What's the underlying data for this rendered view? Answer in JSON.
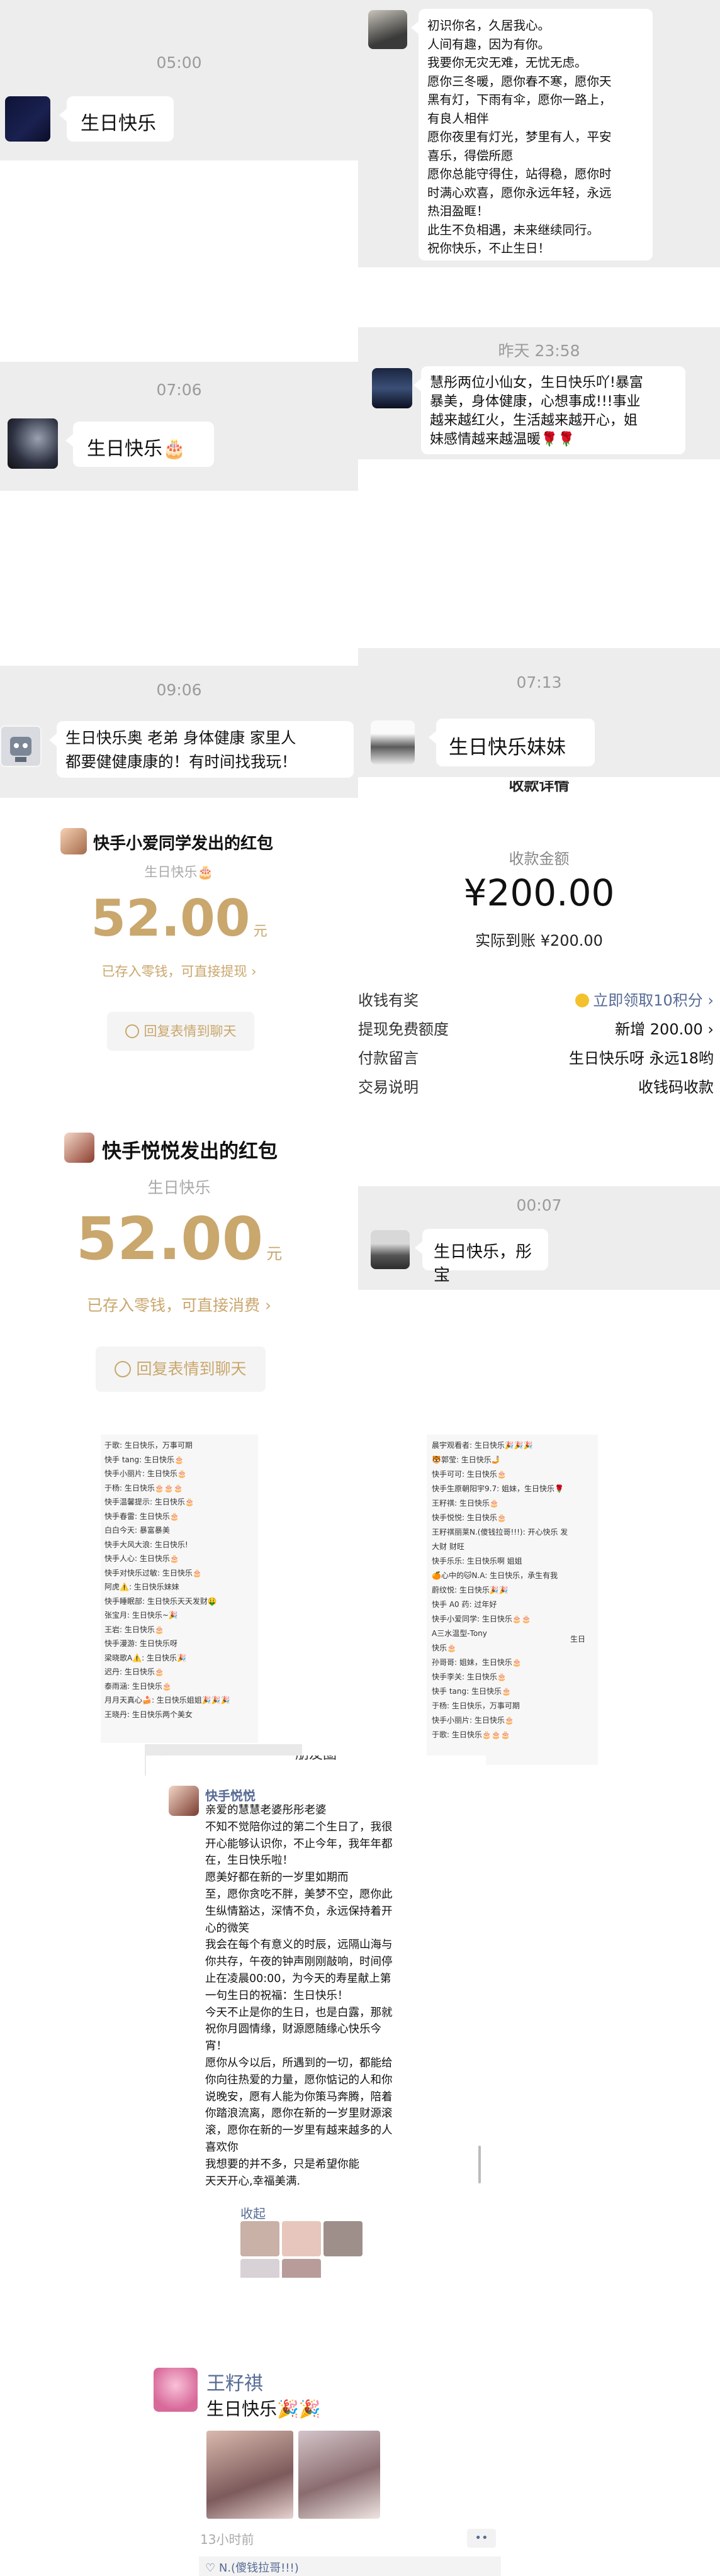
{
  "p1": {
    "time": "05:00",
    "msg": "生日快乐"
  },
  "p2": {
    "time": "07:06",
    "msg": "生日快乐🎂"
  },
  "p3": {
    "time": "09:06",
    "msg_lines": [
      "生日快乐奥 老弟 身体健康 家里人",
      "都要健健康康的！有时间找我玩！"
    ]
  },
  "p4": {
    "title": "快手小爱同学发出的红包",
    "sub": "生日快乐🎂",
    "amount": "52.00",
    "unit": "元",
    "note": "已存入零钱，可直接提现 ›",
    "reply": "回复表情到聊天"
  },
  "p5": {
    "title": "快手悦悦发出的红包",
    "sub": "生日快乐",
    "amount": "52.00",
    "unit": "元",
    "note": "已存入零钱，可直接消费 ›",
    "reply": "回复表情到聊天"
  },
  "p6": {
    "lines": [
      "初识你名，久居我心。",
      "人间有趣，因为有你。",
      "我要你无灾无难，无忧无虑。",
      "愿你三冬暖，愿你春不寒，愿你天",
      "黑有灯，下雨有伞，愿你一路上，",
      "有良人相伴",
      "愿你夜里有灯光，梦里有人，平安",
      "喜乐，得偿所愿",
      "愿你总能守得住，站得稳，愿你时",
      "时满心欢喜，愿你永远年轻，永远",
      "热泪盈眶！",
      "此生不负相遇，未来继续同行。",
      "祝你快乐，不止生日！"
    ]
  },
  "p7": {
    "time": "昨天 23:58",
    "lines": [
      "慧彤两位小仙女，生日快乐吖!暴富",
      "暴美，身体健康，心想事成!!!事业",
      "越来越红火，生活越来越开心，姐",
      "妹感情越来越温暖🌹🌹"
    ]
  },
  "p8": {
    "time": "07:13",
    "msg": "生日快乐妹妹"
  },
  "p9": {
    "header": "收款详情",
    "label": "收款金额",
    "amount": "¥200.00",
    "actual": "实际到账 ¥200.00",
    "rows": [
      {
        "k": "收钱有奖",
        "v": "立即领取10积分 ›"
      },
      {
        "k": "提现免费额度",
        "v": "新增 200.00 ›"
      },
      {
        "k": "付款留言",
        "v": "生日快乐呀 永远18哟"
      },
      {
        "k": "交易说明",
        "v": "收钱码收款"
      }
    ],
    "coin_color": "#f3c12c",
    "link_color": "#576b95"
  },
  "p10": {
    "time": "00:07",
    "msg": "生日快乐，彤宝"
  },
  "p11": {
    "lines": [
      "于歌: 生日快乐，万事可期",
      "快手 tang: 生日快乐🎂",
      "快手小丽片: 生日快乐🎂",
      "于杨: 生日快乐🎂🎂🎂",
      "快手温馨提示: 生日快乐🎂",
      "快手春雷: 生日快乐🎂",
      "白白今天: 暴富暴美",
      "快手大风大浪: 生日快乐!",
      "快手人心: 生日快乐🎂",
      "快手对快乐过敏: 生日快乐🎂",
      "阿虎⚠️: 生日快乐妹妹",
      "快手睡眠部: 生日快乐天天发财🤑",
      "张宝月: 生日快乐~🎉",
      "王岩: 生日快乐🎂",
      "快手漫游: 生日快乐呀",
      "梁晓歌A⚠️: 生日快乐🎉",
      "迟丹: 生日快乐🎂",
      "泰雨涵: 生日快乐🎂",
      "月月天真心🍰: 生日快乐姐姐🎉🎉🎉",
      "王晓丹: 生日快乐两个美女"
    ]
  },
  "p12": {
    "lines": [
      "晨宇观看者: 生日快乐🎉🎉🎉",
      "🐯郭莹: 生日快乐🤳",
      "快手可可: 生日快乐🎂",
      "快手生原朝阳宇9.7: 姐妹，生日快乐🌹",
      "王籽祺: 生日快乐🎂",
      "快手悦悦: 生日快乐🎂",
      "王籽祺丽莱N.(傻钱拉哥!!!): 开心快乐 发",
      "大财 财旺",
      "快手乐乐: 生日快乐啊 姐姐",
      "🍊心中的🐱N.A: 生日快乐，承生有我",
      "蔚纹悦: 生日快乐🎉🎉",
      "快手 A0 药: 过年好",
      "快手小爱同学: 生日快乐🎂🎂",
      "A三水温型-Tony",
      "快乐🎂",
      "孙哥哥: 姐妹，生日快乐🎂",
      "快手李关: 生日快乐🎂",
      "快手 tang: 生日快乐🎂",
      "于杨: 生日快乐，万事可期",
      "快手小丽片: 生日快乐🎂",
      "于歌: 生日快乐🎂🎂🎂"
    ],
    "side": "生日"
  },
  "p13": {
    "hdr": "朋友圈",
    "name": "快手悦悦",
    "lines": [
      "亲爱的慧慧老婆彤彤老婆",
      "不知不觉陪你过的第二个生日了，我很",
      "开心能够认识你，不止今年，我年年都",
      "在，生日快乐啦！",
      "愿美好都在新的一岁里如期而",
      "至，愿你贪吃不胖，美梦不空，愿你此",
      "生纵情豁达，深情不负，永远保持着开",
      "心的微笑",
      "我会在每个有意义的时辰，远隔山海与",
      "你共存，午夜的钟声刚刚敲响，时间停",
      "止在凌晨00:00，为今天的寿星献上第",
      "一句生日的祝福：生日快乐！",
      "今天不止是你的生日，也是白露，那就",
      "祝你月圆情缘，财源愿随缘心快乐今",
      "宵！",
      "愿你从今以后，所遇到的一切，都能给",
      "你向往热爱的力量，愿你惦记的人和你",
      "说晚安，愿有人能为你策马奔腾，陪着",
      "你踏浪流离，愿你在新的一岁里财源滚",
      "滚，愿你在新的一岁里有越来越多的人",
      "喜欢你",
      "我想要的并不多，只是希望你能",
      "天天开心,幸福美满."
    ],
    "collapse": "收起"
  },
  "p14": {
    "name": "王籽祺",
    "msg": "生日快乐🎉🎉",
    "ago": "13小时前",
    "name_color": "#576b95",
    "footer": "♡ N.(傻钱拉哥!!!)"
  }
}
